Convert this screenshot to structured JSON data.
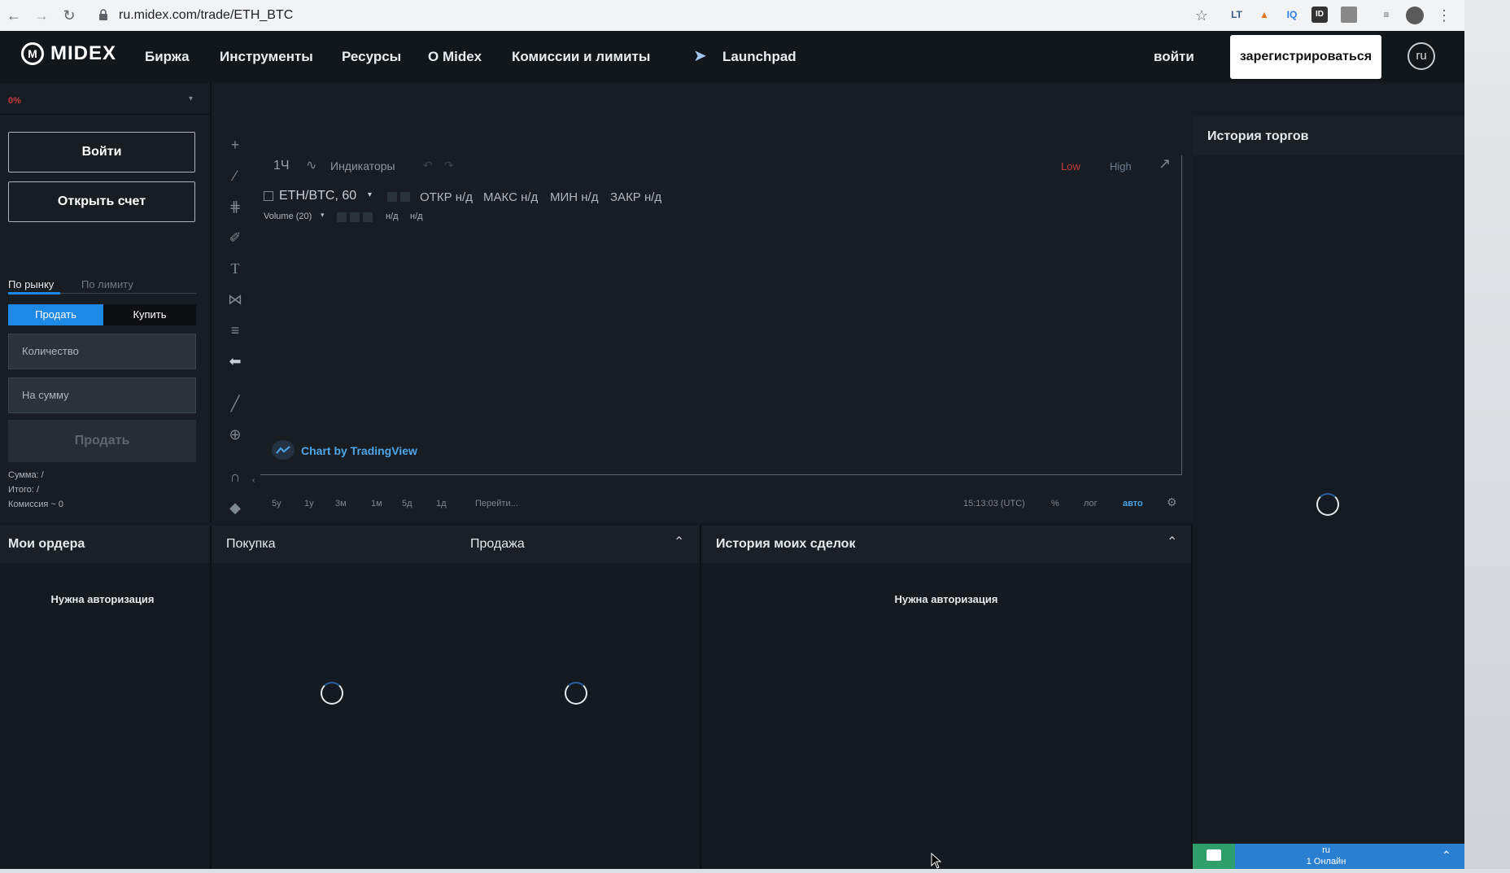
{
  "browser": {
    "url": "ru.midex.com/trade/ETH_BTC",
    "ext_labels": [
      "LT",
      "IQ",
      "ID"
    ]
  },
  "header": {
    "logo": "MIDEX",
    "nav": [
      "Биржа",
      "Инструменты",
      "Ресурсы",
      "О Midex",
      "Комиссии и лимиты"
    ],
    "launchpad": "Launchpad",
    "login": "войти",
    "register": "зарегистрироваться",
    "lang": "ru"
  },
  "left": {
    "percent": "0%",
    "login_btn": "Войти",
    "open_account_btn": "Открыть счет",
    "tab_market": "По рынку",
    "tab_limit": "По лимиту",
    "sell_tab": "Продать",
    "buy_tab": "Купить",
    "qty_placeholder": "Количество",
    "sum_placeholder": "На сумму",
    "sell_button": "Продать",
    "summary_sum": "Сумма:  /",
    "summary_total": "Итого:  /",
    "summary_fee": "Комиссия  ~ 0"
  },
  "chart_header": {
    "interval": "1Ч",
    "indicators": "Индикаторы",
    "low": "Low",
    "high": "High",
    "symbol": "ETH/BTC, 60",
    "open": "ОТКР н/д",
    "max": "МАКС н/д",
    "min": "МИН н/д",
    "close": "ЗАКР н/д",
    "volume": "Volume (20)",
    "vol_val1": "н/д",
    "vol_val2": "н/д",
    "credit": "Chart by TradingView"
  },
  "chart_footer": {
    "ranges": [
      "5у",
      "1у",
      "3м",
      "1м",
      "5д",
      "1д"
    ],
    "goto": "Перейти...",
    "time": "15:13:03 (UTC)",
    "percent": "%",
    "log": "лог",
    "auto": "авто"
  },
  "history": {
    "title": "История торгов"
  },
  "orders": {
    "title": "Мои ордера",
    "auth": "Нужна авторизация"
  },
  "book": {
    "buy": "Покупка",
    "sell": "Продажа"
  },
  "deals": {
    "title": "История моих сделок",
    "auth": "Нужна авторизация"
  },
  "chat": {
    "lang": "ru",
    "online": "1 Онлайн"
  },
  "colors": {
    "accent": "#1e88e5",
    "low": "#c23b3b",
    "high": "#6a7d93",
    "link": "#4ea6e8"
  }
}
